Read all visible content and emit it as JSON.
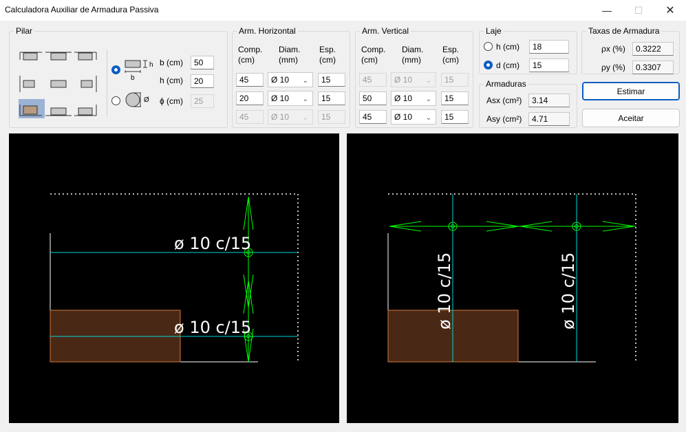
{
  "window": {
    "title": "Calculadora Auxiliar de Armadura Passiva"
  },
  "pilar": {
    "group_title": "Pilar",
    "b_label": "b (cm)",
    "b_value": "50",
    "h_label": "h (cm)",
    "h_value": "20",
    "phi_label": "ϕ (cm)",
    "phi_value": "25",
    "rect_icon_h": "h",
    "rect_icon_b": "b",
    "circ_icon_phi": "Ø",
    "shape": "rectangular"
  },
  "arm_horizontal": {
    "group_title": "Arm. Horizontal",
    "col_comp": "Comp.\n(cm)",
    "col_diam": "Diam.\n(mm)",
    "col_esp": "Esp.\n(cm)",
    "rows": [
      {
        "comp": "45",
        "diam": "Ø 10",
        "esp": "15",
        "enabled": true
      },
      {
        "comp": "20",
        "diam": "Ø 10",
        "esp": "15",
        "enabled": true
      },
      {
        "comp": "45",
        "diam": "Ø 10",
        "esp": "15",
        "enabled": false
      }
    ]
  },
  "arm_vertical": {
    "group_title": "Arm. Vertical",
    "col_comp": "Comp.\n(cm)",
    "col_diam": "Diam.\n(mm)",
    "col_esp": "Esp.\n(cm)",
    "rows": [
      {
        "comp": "45",
        "diam": "Ø 10",
        "esp": "15",
        "enabled": false
      },
      {
        "comp": "50",
        "diam": "Ø 10",
        "esp": "15",
        "enabled": true
      },
      {
        "comp": "45",
        "diam": "Ø 10",
        "esp": "15",
        "enabled": true
      }
    ]
  },
  "laje": {
    "group_title": "Laje",
    "h_label": "h (cm)",
    "h_value": "18",
    "d_label": "d (cm)",
    "d_value": "15",
    "selected": "d"
  },
  "armaduras": {
    "group_title": "Armaduras",
    "asx_label": "Asx (cm²)",
    "asx_value": "3.14",
    "asy_label": "Asy (cm²)",
    "asy_value": "4.71"
  },
  "taxas": {
    "group_title": "Taxas de Armadura",
    "px_label": "ρx (%)",
    "px_value": "0.3222",
    "py_label": "ρy (%)",
    "py_value": "0.3307"
  },
  "buttons": {
    "estimar": "Estimar",
    "aceitar": "Aceitar"
  },
  "drawing_left": {
    "label_top": "ø 10 c/15",
    "label_bottom": "ø 10 c/15"
  },
  "drawing_right": {
    "label_left": "ø 10 c/15",
    "label_right": "ø 10 c/15"
  },
  "colors": {
    "accent": "#0a5cc2",
    "column_fill": "#4a2816",
    "column_stroke": "#d07a3c",
    "rebar": "#00ff00",
    "guide": "#00d8d8",
    "canvas_bg": "#000000"
  }
}
